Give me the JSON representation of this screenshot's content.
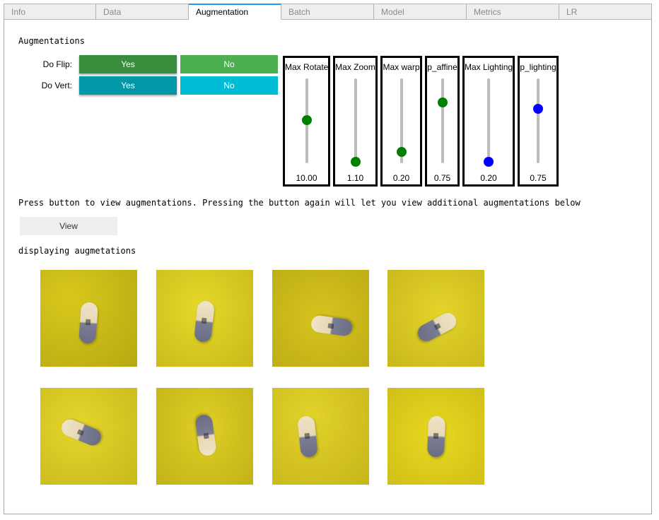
{
  "tabs": [
    {
      "label": "Info",
      "active": false
    },
    {
      "label": "Data",
      "active": false
    },
    {
      "label": "Augmentation",
      "active": true
    },
    {
      "label": "Batch",
      "active": false
    },
    {
      "label": "Model",
      "active": false
    },
    {
      "label": "Metrics",
      "active": false
    },
    {
      "label": "LR",
      "active": false
    }
  ],
  "section_title": "Augmentations",
  "flip": {
    "label": "Do Flip:",
    "yes": "Yes",
    "no": "No",
    "selected": "Yes"
  },
  "vert": {
    "label": "Do Vert:",
    "yes": "Yes",
    "no": "No",
    "selected": "Yes"
  },
  "sliders": [
    {
      "title": "Max Rotate",
      "value": "10.00",
      "fraction": 0.51,
      "color": "#008000"
    },
    {
      "title": "Max Zoom",
      "value": "1.10",
      "fraction": 0.02,
      "color": "#008000"
    },
    {
      "title": "Max warp",
      "value": "0.20",
      "fraction": 0.13,
      "color": "#008000"
    },
    {
      "title": "p_affine",
      "value": "0.75",
      "fraction": 0.72,
      "color": "#008000"
    },
    {
      "title": "Max Lighting",
      "value": "0.20",
      "fraction": 0.02,
      "color": "#0000ff"
    },
    {
      "title": "p_lighting",
      "value": "0.75",
      "fraction": 0.64,
      "color": "#0000ff"
    }
  ],
  "instruction": "Press button to view augmentations.  Pressing the button again will let you view additional augmentations below",
  "view_button": "View",
  "display_label": "displaying augmetations",
  "colors": {
    "yellow_bg": "#d9c820",
    "accent_tab": "#2196f3"
  }
}
